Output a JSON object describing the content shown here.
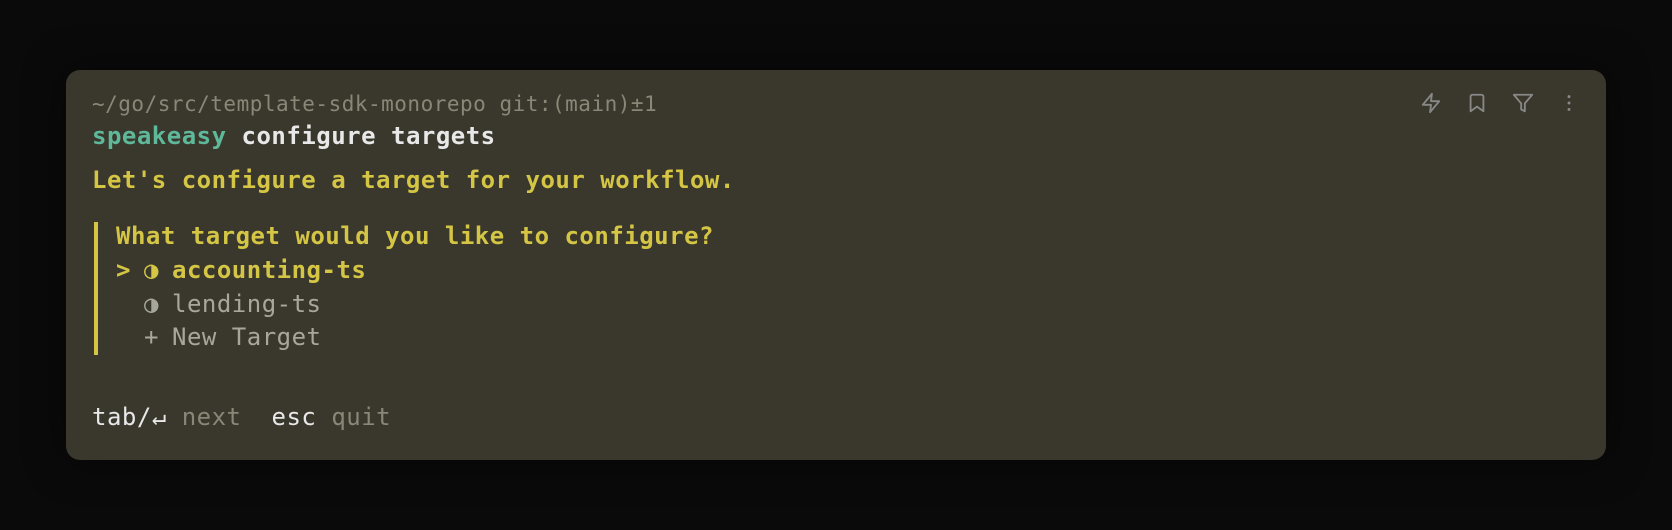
{
  "path": {
    "cwd": "~/go/src/template-sdk-monorepo",
    "vcs": " git:(main)±1"
  },
  "command": {
    "name": "speakeasy",
    "args": " configure targets"
  },
  "intro": "Let's configure a target for your workflow.",
  "prompt": {
    "question": "What target would you like to configure?",
    "cursor": ">",
    "tag_bullet": "◑",
    "plus_bullet": "+",
    "options": [
      {
        "label": "accounting-ts",
        "selected": true,
        "kind": "tag"
      },
      {
        "label": "lending-ts",
        "selected": false,
        "kind": "tag"
      },
      {
        "label": "New Target",
        "selected": false,
        "kind": "plus"
      }
    ]
  },
  "footer": {
    "key1": "tab/↵",
    "action1": "next",
    "key2": "esc",
    "action2": "quit"
  }
}
